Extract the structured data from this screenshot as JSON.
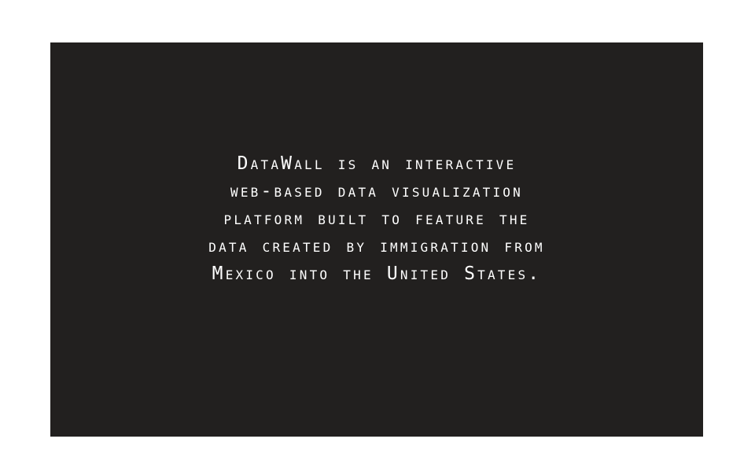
{
  "colors": {
    "page_background": "#ffffff",
    "panel_background": "#22201f",
    "text": "#ffffff"
  },
  "intro": {
    "lines": [
      "DataWall is an interactive",
      "web-based data visualization",
      "platform built to feature the",
      "data created by immigration from",
      "Mexico into the United States."
    ]
  }
}
